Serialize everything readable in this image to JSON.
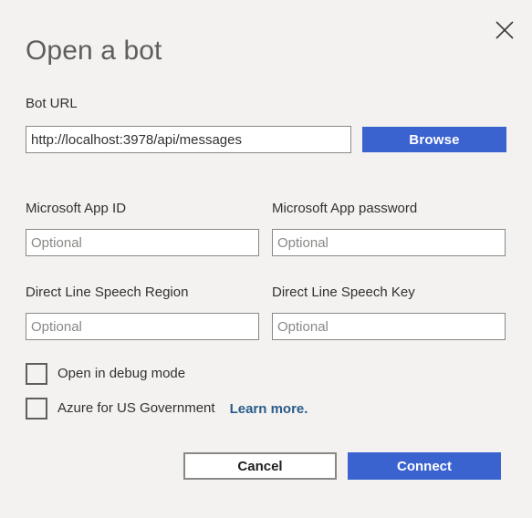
{
  "dialog": {
    "title": "Open a bot",
    "close_icon": "close-icon",
    "background_color": "#f3f2f1"
  },
  "bot_url": {
    "label": "Bot URL",
    "value": "http://localhost:3978/api/messages",
    "placeholder": "",
    "browse_label": "Browse"
  },
  "fields": {
    "app_id": {
      "label": "Microsoft App ID",
      "value": "",
      "placeholder": "Optional"
    },
    "app_password": {
      "label": "Microsoft App password",
      "value": "",
      "placeholder": "Optional"
    },
    "speech_region": {
      "label": "Direct Line Speech Region",
      "value": "",
      "placeholder": "Optional"
    },
    "speech_key": {
      "label": "Direct Line Speech Key",
      "value": "",
      "placeholder": "Optional"
    }
  },
  "checkboxes": {
    "debug_mode": {
      "label": "Open in debug mode",
      "checked": false
    },
    "us_government": {
      "label": "Azure for US Government",
      "checked": false,
      "link_label": "Learn more."
    }
  },
  "footer": {
    "cancel_label": "Cancel",
    "connect_label": "Connect"
  },
  "colors": {
    "accent_blue": "#3b63d0",
    "link_blue": "#2b5c8a",
    "border_gray": "#8a8886",
    "text_dark": "#323130",
    "title_gray": "#605e5c"
  }
}
